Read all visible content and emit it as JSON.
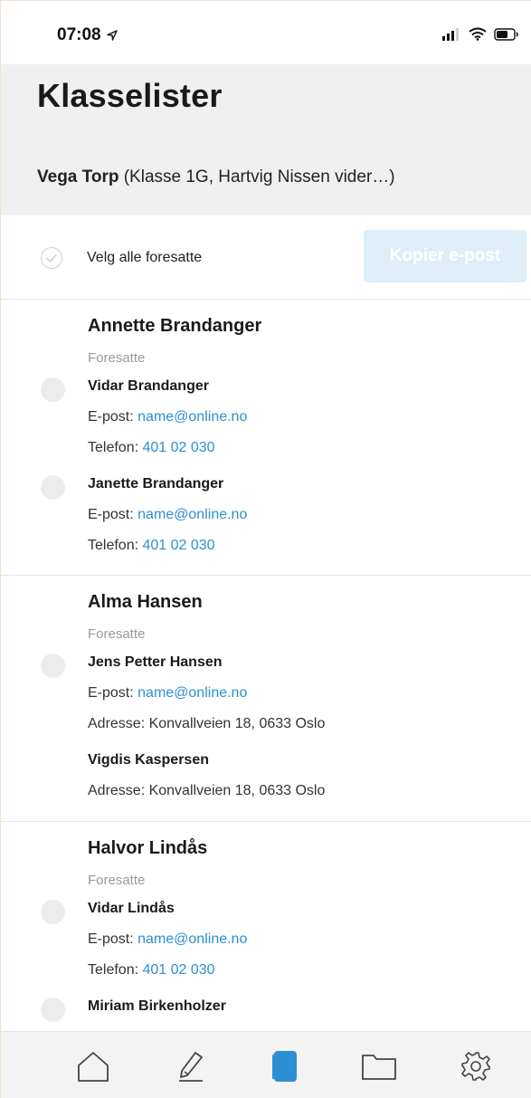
{
  "status": {
    "time": "07:08",
    "icons": [
      "location-arrow-icon",
      "signal-icon",
      "wifi-icon",
      "battery-icon"
    ]
  },
  "header": {
    "title": "Klasselister",
    "subtitle_name": "Vega Torp",
    "subtitle_rest": " (Klasse 1G, Hartvig Nissen vider…)"
  },
  "selectbar": {
    "select_all_label": "Velg alle foresatte",
    "copy_button": "Kopier e-post"
  },
  "students": [
    {
      "name": "Annette Brandanger",
      "guardians_label": "Foresatte",
      "guardians": [
        {
          "name": "Vidar Brandanger",
          "email_label": "E-post: ",
          "email": "name@online.no",
          "phone_label": "Telefon: ",
          "phone": "401 02 030"
        },
        {
          "name": "Janette Brandanger",
          "email_label": "E-post: ",
          "email": "name@online.no",
          "phone_label": "Telefon: ",
          "phone": "401 02 030"
        }
      ]
    },
    {
      "name": "Alma Hansen",
      "guardians_label": "Foresatte",
      "guardians": [
        {
          "name": "Jens Petter Hansen",
          "email_label": "E-post: ",
          "email": "name@online.no",
          "address": "Adresse: Konvallveien 18, 0633 Oslo"
        },
        {
          "name": "Vigdis Kaspersen",
          "address": "Adresse: Konvallveien 18, 0633 Oslo"
        }
      ]
    },
    {
      "name": "Halvor Lindås",
      "guardians_label": "Foresatte",
      "guardians": [
        {
          "name": "Vidar Lindås",
          "email_label": "E-post: ",
          "email": "name@online.no",
          "phone_label": "Telefon: ",
          "phone": "401 02 030"
        },
        {
          "name": "Miriam Birkenholzer"
        }
      ]
    }
  ],
  "tabbar": {
    "tabs": [
      "home-icon",
      "pencil-icon",
      "class-list-icon",
      "folder-icon",
      "settings-icon"
    ],
    "active_index": 2,
    "active_color": "#2d8fd3",
    "inactive_color": "#444444"
  },
  "colors": {
    "link": "#2d8fd3",
    "button_disabled_bg": "#ddeef9",
    "header_bg": "#f0f0f0"
  }
}
